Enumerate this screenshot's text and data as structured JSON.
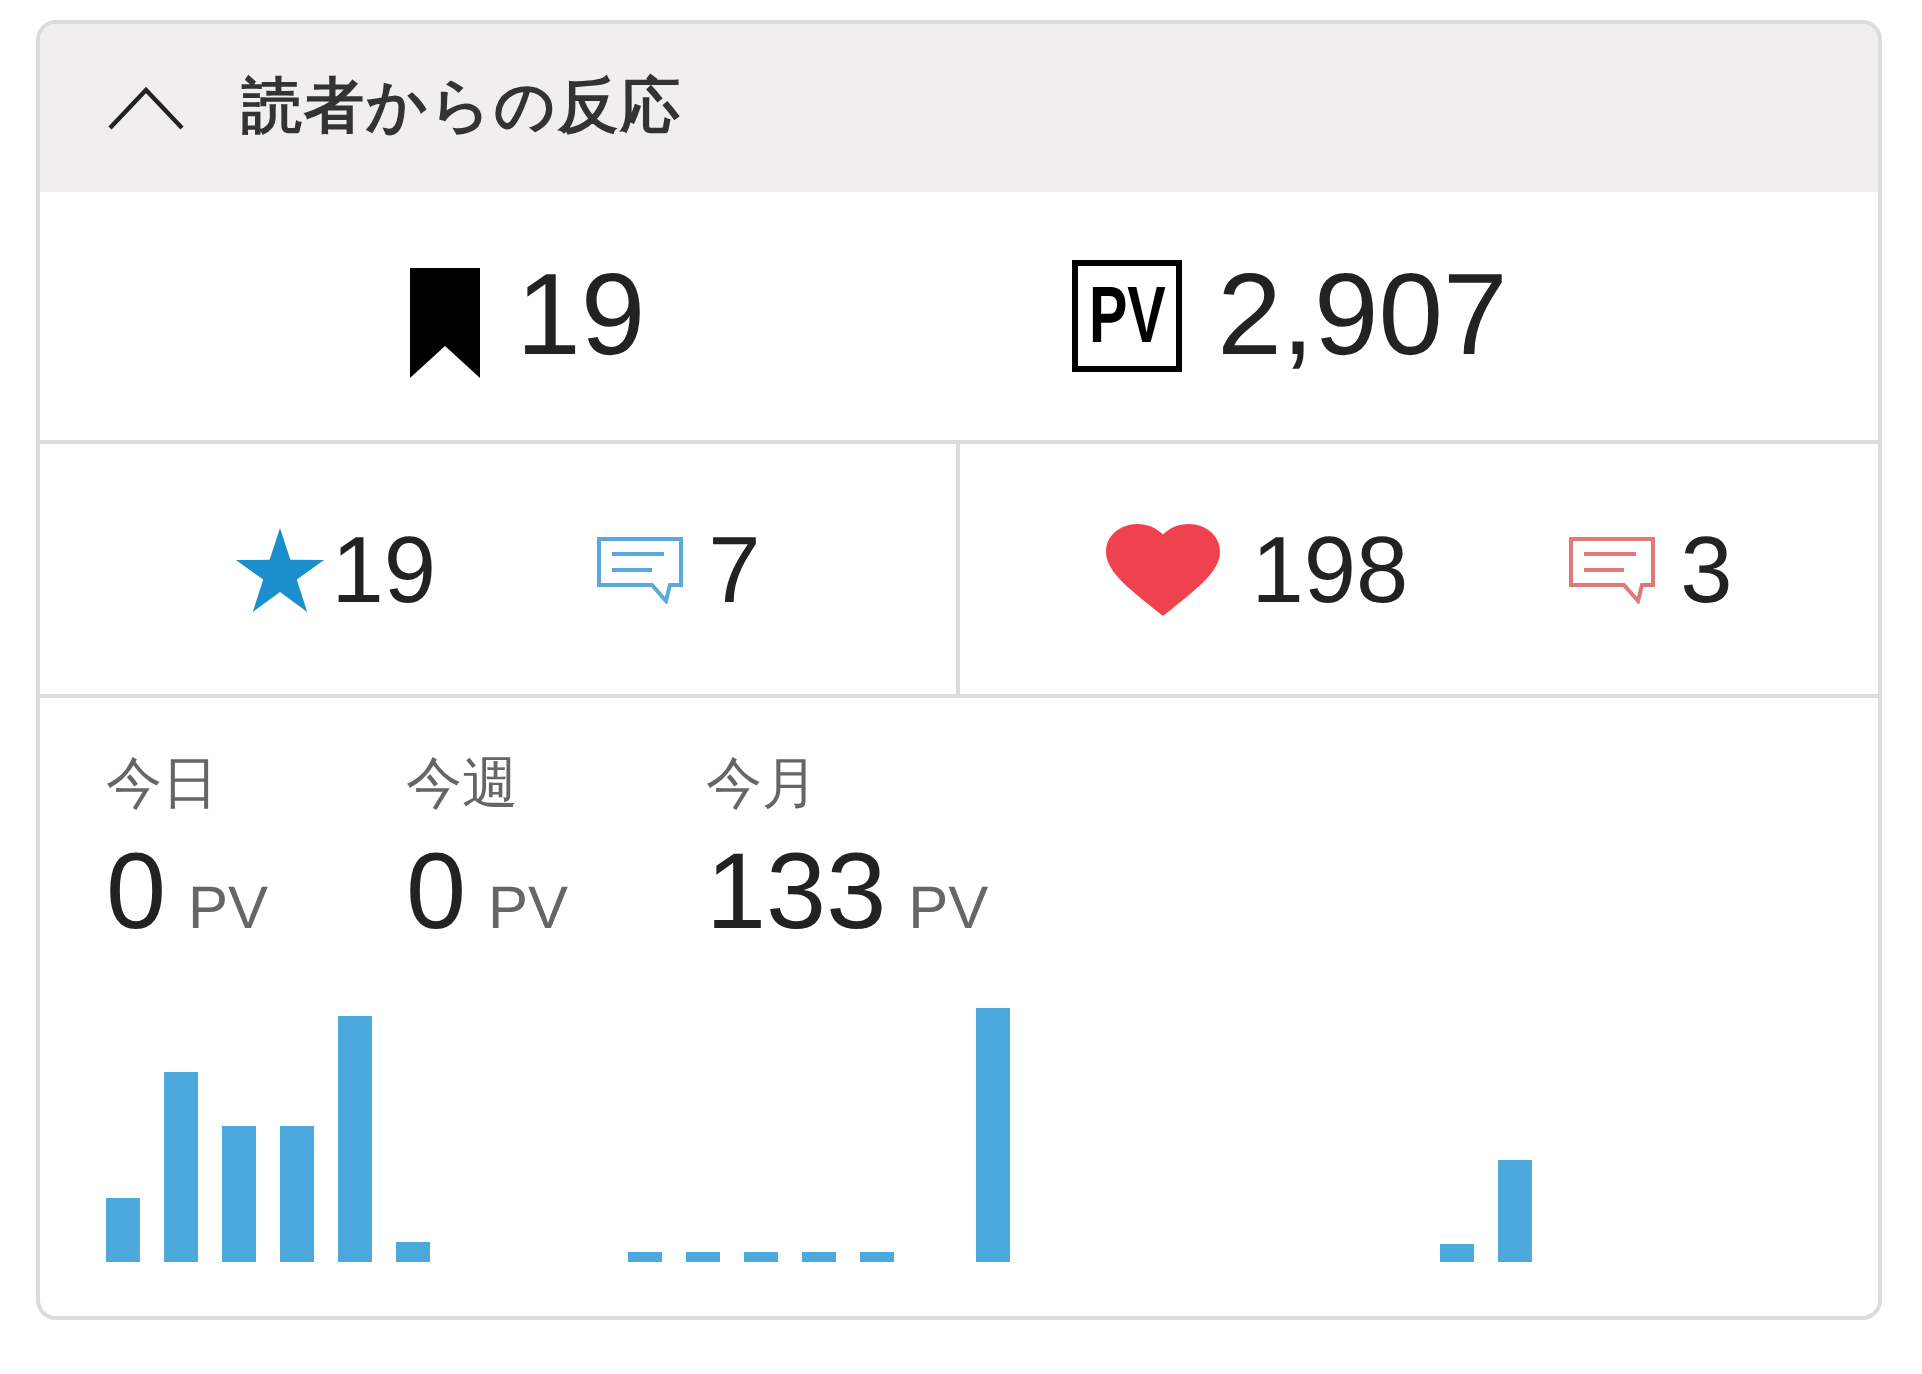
{
  "panel": {
    "title": "読者からの反応",
    "expanded": true
  },
  "totals": [
    {
      "kind": "bookmarks",
      "count": "19"
    },
    {
      "kind": "pageviews",
      "badge": "PV",
      "count": "2,907"
    }
  ],
  "reactions": [
    {
      "kind": "star",
      "count": "19",
      "comment_count": "7",
      "color": "#5aa9d6"
    },
    {
      "kind": "heart",
      "count": "198",
      "comment_count": "3",
      "color": "#e07a7a"
    }
  ],
  "periods": [
    {
      "label": "今日",
      "value": "0",
      "unit": "PV"
    },
    {
      "label": "今週",
      "value": "0",
      "unit": "PV"
    },
    {
      "label": "今月",
      "value": "133",
      "unit": "PV"
    }
  ]
}
